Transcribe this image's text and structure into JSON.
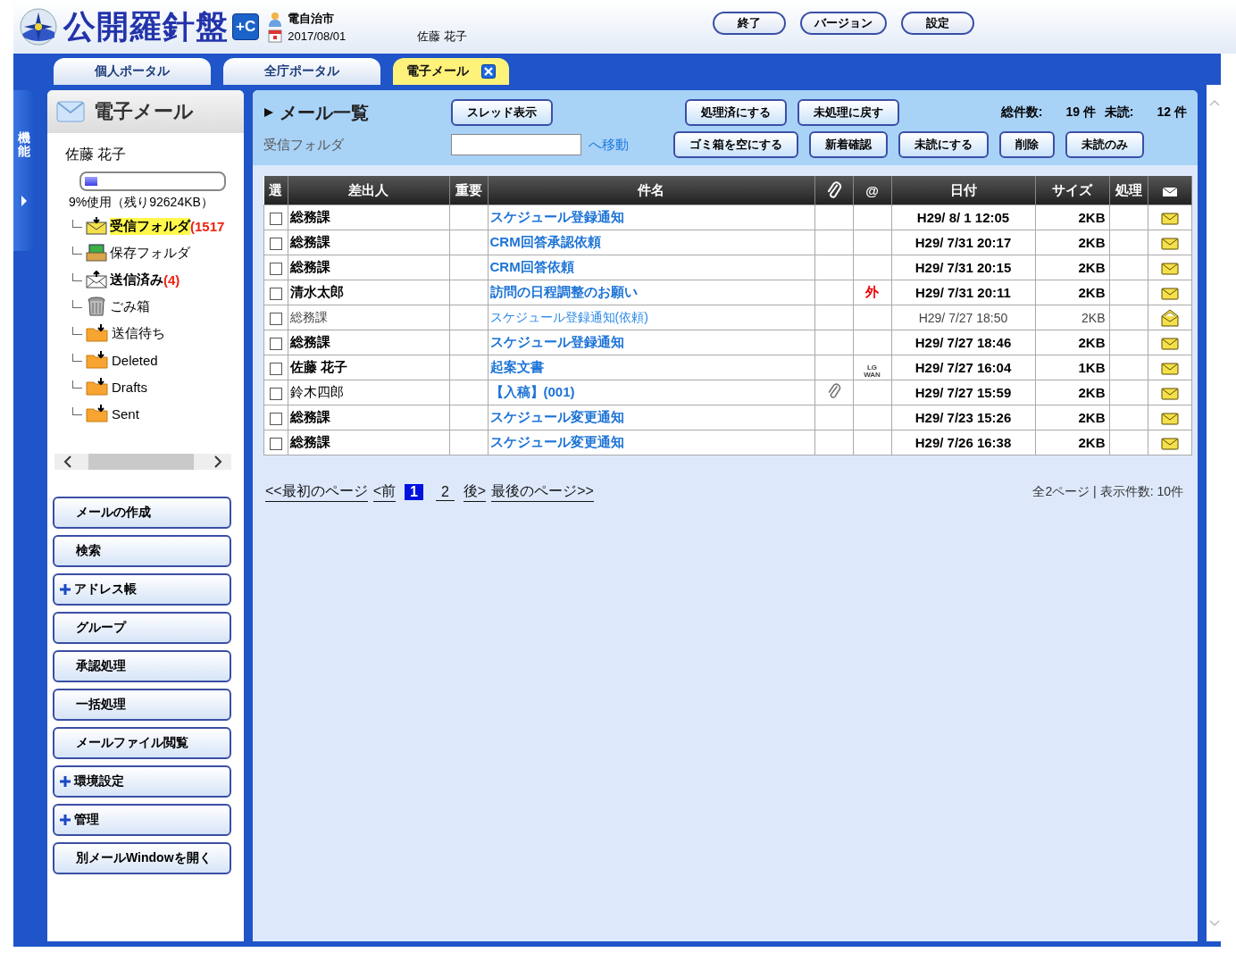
{
  "header": {
    "logo": "公開羅針盤",
    "logo_badge": "+C",
    "organization": "電自治市",
    "date": "2017/08/01",
    "user": "佐藤 花子",
    "buttons": [
      "終了",
      "バージョン",
      "設定"
    ]
  },
  "tabs": [
    {
      "label": "個人ポータル",
      "selected": false,
      "closable": false
    },
    {
      "label": "全庁ポータル",
      "selected": false,
      "closable": false
    },
    {
      "label": "電子メール",
      "selected": true,
      "closable": true
    }
  ],
  "side_tab": {
    "label": "機能"
  },
  "sidebar": {
    "title": "電子メール",
    "user": "佐藤 花子",
    "usage": {
      "level": 0.09,
      "text": "9%使用（残り92624KB）"
    },
    "folders": [
      {
        "kind": "inbox",
        "name": "受信フォルダ",
        "count": "(1517",
        "selected": true,
        "bold": true
      },
      {
        "kind": "saved",
        "name": "保存フォルダ",
        "selected": false,
        "bold": false
      },
      {
        "kind": "sent",
        "name": "送信済み",
        "count": "(4)",
        "selected": false,
        "bold": true
      },
      {
        "kind": "trash",
        "name": "ごみ箱",
        "selected": false,
        "bold": false
      },
      {
        "kind": "folder",
        "name": "送信待ち",
        "selected": false,
        "bold": false
      },
      {
        "kind": "folder",
        "name": "Deleted",
        "selected": false,
        "bold": false
      },
      {
        "kind": "folder",
        "name": "Drafts",
        "selected": false,
        "bold": false
      },
      {
        "kind": "folder",
        "name": "Sent",
        "selected": false,
        "bold": false
      }
    ],
    "menu": [
      {
        "label": "メールの作成",
        "expandable": false
      },
      {
        "label": "検索",
        "expandable": false
      },
      {
        "label": "アドレス帳",
        "expandable": true
      },
      {
        "label": "グループ",
        "expandable": false
      },
      {
        "label": "承認処理",
        "expandable": false
      },
      {
        "label": "一括処理",
        "expandable": false
      },
      {
        "label": "メールファイル閲覧",
        "expandable": false
      },
      {
        "label": "環境設定",
        "expandable": true
      },
      {
        "label": "管理",
        "expandable": true
      },
      {
        "label": "別メールWindowを開く",
        "expandable": false
      }
    ]
  },
  "mail_list": {
    "title": "メール一覧",
    "folder_label": "受信フォルダ",
    "move_link": "へ移動",
    "toolbar_row1": [
      "スレッド表示",
      "処理済にする",
      "未処理に戻す"
    ],
    "toolbar_row2": [
      "ゴミ箱を空にする",
      "新着確認",
      "未読にする",
      "削除",
      "未読のみ"
    ],
    "total_label": "総件数:",
    "total": "19 件",
    "unread_label": "未読:",
    "unread": "12 件",
    "columns": [
      "選",
      "差出人",
      "重要",
      "件名",
      "",
      "@",
      "日付",
      "サイズ",
      "処理",
      ""
    ],
    "rows": [
      {
        "checked": false,
        "unread": true,
        "sender_bold": true,
        "sender": "総務課",
        "subject": "スケジュール登録通知",
        "attachment": false,
        "date": "H29/ 8/ 1 12:05",
        "size": "2KB"
      },
      {
        "checked": false,
        "unread": true,
        "sender_bold": true,
        "sender": "総務課",
        "subject": "CRM回答承認依頼",
        "attachment": false,
        "date": "H29/ 7/31 20:17",
        "size": "2KB"
      },
      {
        "checked": false,
        "unread": true,
        "sender_bold": true,
        "sender": "総務課",
        "subject": "CRM回答依頼",
        "attachment": false,
        "date": "H29/ 7/31 20:15",
        "size": "2KB"
      },
      {
        "checked": false,
        "unread": true,
        "sender_bold": true,
        "sender": "清水太郎",
        "subject": "訪問の日程調整のお願い",
        "attachment": false,
        "net": {
          "kind": "external",
          "lines": [
            "外"
          ]
        },
        "date": "H29/ 7/31 20:11",
        "size": "2KB"
      },
      {
        "checked": false,
        "unread": false,
        "sender_bold": false,
        "sender": "総務課",
        "subject": "スケジュール登録通知(依頼)",
        "attachment": false,
        "date": "H29/ 7/27 18:50",
        "size": "2KB"
      },
      {
        "checked": false,
        "unread": true,
        "sender_bold": true,
        "sender": "総務課",
        "subject": "スケジュール登録通知",
        "attachment": false,
        "date": "H29/ 7/27 18:46",
        "size": "2KB"
      },
      {
        "checked": false,
        "unread": true,
        "sender_bold": true,
        "sender": "佐藤 花子",
        "subject": "起案文書",
        "attachment": false,
        "net": {
          "kind": "lgwan",
          "lines": [
            "LG",
            "WAN"
          ]
        },
        "date": "H29/ 7/27 16:04",
        "size": "1KB"
      },
      {
        "checked": false,
        "unread": true,
        "sender_bold": false,
        "sender": "鈴木四郎",
        "subject": "【入稿】(001)",
        "attachment": true,
        "date": "H29/ 7/27 15:59",
        "size": "2KB"
      },
      {
        "checked": false,
        "unread": true,
        "sender_bold": true,
        "sender": "総務課",
        "subject": "スケジュール変更通知",
        "attachment": false,
        "date": "H29/ 7/23 15:26",
        "size": "2KB"
      },
      {
        "checked": false,
        "unread": true,
        "sender_bold": true,
        "sender": "総務課",
        "subject": "スケジュール変更通知",
        "attachment": false,
        "date": "H29/ 7/26 16:38",
        "size": "2KB"
      }
    ],
    "pagination": {
      "first": "<<最初のページ",
      "prev": "<前",
      "pages": [
        {
          "label": "1",
          "selected": true
        },
        {
          "label": "2",
          "selected": false
        }
      ],
      "next": "後>",
      "last": "最後のページ>>",
      "summary": "全2ページ | 表示件数: 10件"
    }
  }
}
